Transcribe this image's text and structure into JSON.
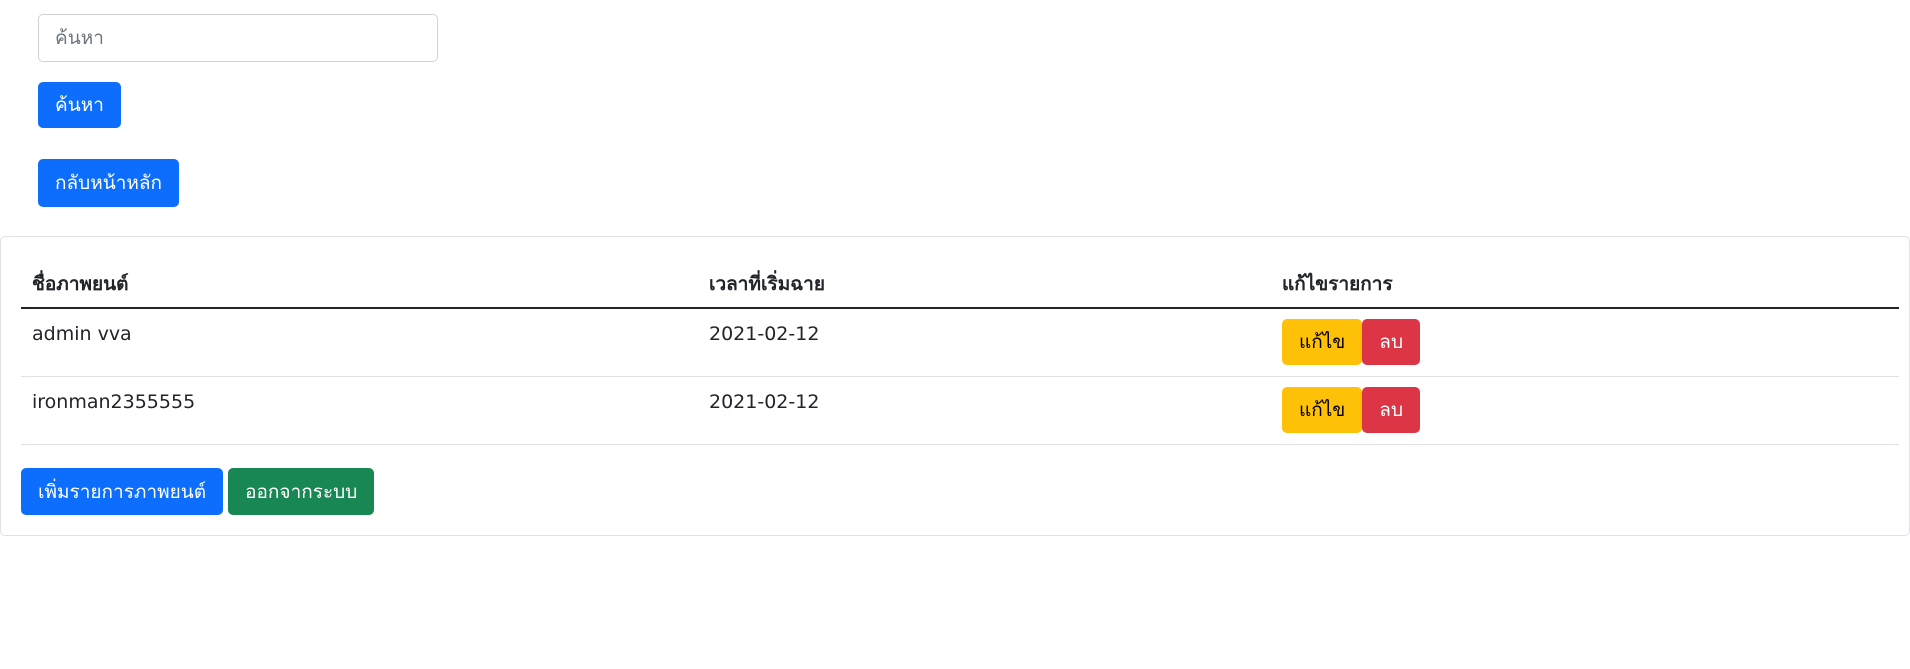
{
  "search": {
    "placeholder": "ค้นหา",
    "value": "",
    "button_label": "ค้นหา"
  },
  "nav": {
    "home_label": "กลับหน้าหลัก"
  },
  "table": {
    "headers": {
      "name": "ชื่อภาพยนต์",
      "start_time": "เวลาที่เริ่มฉาย",
      "actions": "แก้ไขรายการ"
    },
    "rows": [
      {
        "name": "admin vva",
        "start_time": "2021-02-12",
        "edit_label": "แก้ไข",
        "delete_label": "ลบ"
      },
      {
        "name": "ironman2355555",
        "start_time": "2021-02-12",
        "edit_label": "แก้ไข",
        "delete_label": "ลบ"
      }
    ]
  },
  "footer": {
    "add_label": "เพิ่มรายการภาพยนต์",
    "logout_label": "ออกจากระบบ"
  },
  "colors": {
    "primary": "#0d6efd",
    "success": "#198754",
    "warning": "#ffc107",
    "danger": "#dc3545"
  }
}
